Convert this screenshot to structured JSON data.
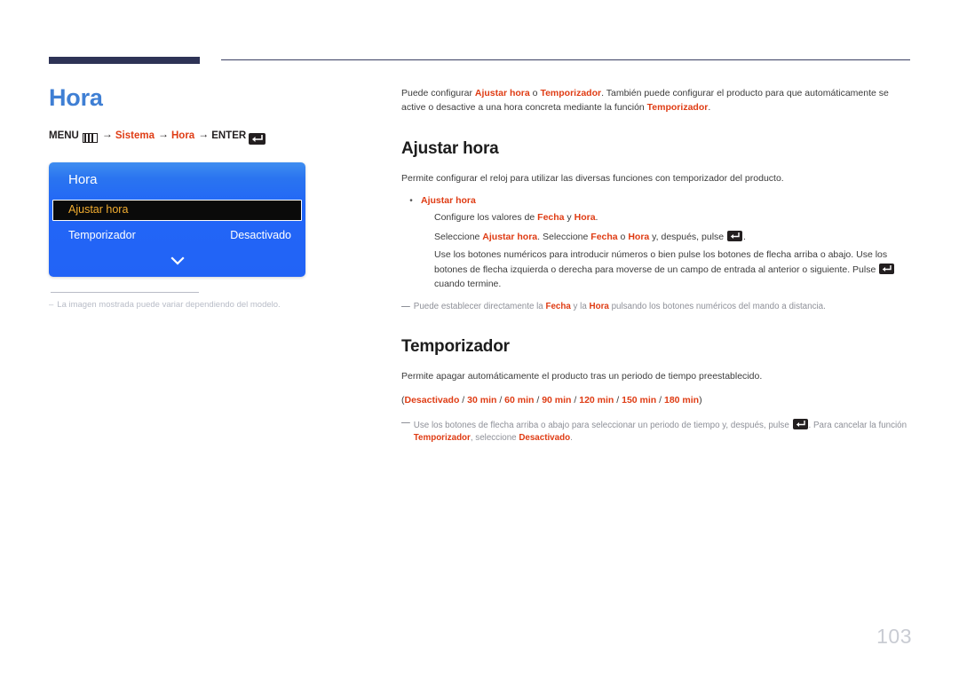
{
  "header": {
    "rule_color": "#2e3356"
  },
  "left": {
    "page_title": "Hora",
    "breadcrumb": {
      "menu_label": "MENU",
      "menu_icon": "menu-grid-icon",
      "arrow": "→",
      "step1": "Sistema",
      "step2": "Hora",
      "enter_label": "ENTER",
      "enter_icon": "enter-key-icon"
    },
    "osd": {
      "title": "Hora",
      "highlighted_item": "Ajustar hora",
      "rows": [
        {
          "label": "Temporizador",
          "value": "Desactivado"
        }
      ],
      "chevron_icon": "chevron-down-icon",
      "accent_blue": "#2263f6",
      "highlight_text_color": "#f2ad30"
    },
    "note": {
      "dash": "–",
      "text": "La imagen mostrada puede variar dependiendo del modelo."
    }
  },
  "right": {
    "intro": {
      "p1_a": "Puede configurar ",
      "p1_b": "Ajustar hora",
      "p1_c": " o ",
      "p1_d": "Temporizador",
      "p1_e": ". También puede configurar el producto para que automáticamente se active o desactive a una hora concreta mediante la función ",
      "p1_f": "Temporizador",
      "p1_g": "."
    },
    "section1": {
      "heading": "Ajustar hora",
      "lead": "Permite configurar el reloj para utilizar las diversas funciones con temporizador del producto.",
      "bullet": {
        "marker": "•",
        "title": "Ajustar hora",
        "line1_a": "Configure los valores de ",
        "line1_b": "Fecha",
        "line1_c": " y ",
        "line1_d": "Hora",
        "line1_e": ".",
        "line2_a": "Seleccione ",
        "line2_b": "Ajustar hora",
        "line2_c": ". Seleccione ",
        "line2_d": "Fecha",
        "line2_e": " o ",
        "line2_f": "Hora",
        "line2_g": " y, después, pulse ",
        "line2_h": ".",
        "line3_a": "Use los botones numéricos para introducir números o bien pulse los botones de flecha arriba o abajo. Use los botones de flecha izquierda o derecha para moverse de un campo de entrada al anterior o siguiente. Pulse ",
        "line3_b": " cuando termine."
      },
      "footnote": {
        "dash": "—",
        "a": "Puede establecer directamente la ",
        "b": "Fecha",
        "c": " y la ",
        "d": "Hora",
        "e": " pulsando los botones numéricos del mando a distancia."
      }
    },
    "section2": {
      "heading": "Temporizador",
      "lead": "Permite apagar automáticamente el producto tras un periodo de tiempo preestablecido.",
      "options_open": "(",
      "options": [
        "Desactivado",
        "30 min",
        "60 min",
        "90 min",
        "120 min",
        "150 min",
        "180 min"
      ],
      "options_sep": " / ",
      "options_close": ")",
      "footnote": {
        "dash": "—",
        "a": "Use los botones de flecha arriba o abajo para seleccionar un periodo de tiempo y, después, pulse ",
        "b": ". Para cancelar la función ",
        "c": "Temporizador",
        "d": ", seleccione ",
        "e": "Desactivado",
        "f": "."
      }
    }
  },
  "footer": {
    "page_number": "103"
  }
}
